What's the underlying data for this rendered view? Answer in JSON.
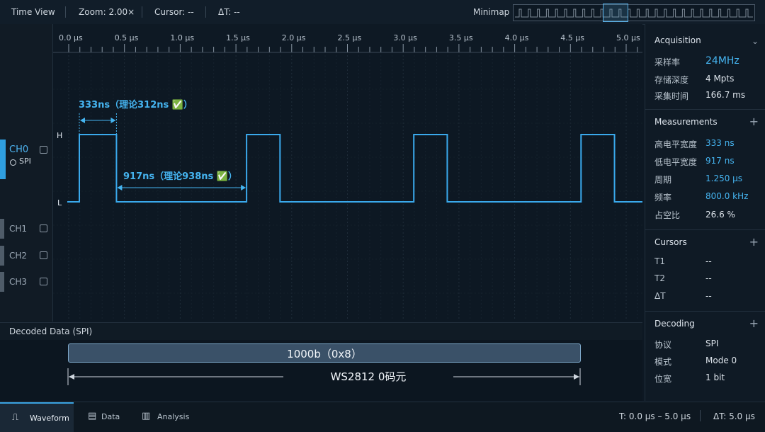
{
  "topbar": {
    "title": "Time View",
    "zoom": "Zoom:  2.00×",
    "cursor": "Cursor:  --",
    "delta": "ΔT:  --",
    "minimap_label": "Minimap"
  },
  "channels": [
    {
      "label": "CH0",
      "sub": "SPI",
      "color": "#2f9fe0",
      "active": true
    },
    {
      "label": "CH1",
      "color": "#4f5c69",
      "active": false
    },
    {
      "label": "CH2",
      "color": "#4f5c69",
      "active": false
    },
    {
      "label": "CH3",
      "color": "#4f5c69",
      "active": false
    }
  ],
  "ruler": {
    "ticks": [
      "0.0 μs",
      "0.5 μs",
      "1.0 μs",
      "1.5 μs",
      "2.0 μs",
      "2.5 μs",
      "3.0 μs",
      "3.5 μs",
      "4.0 μs",
      "4.5 μs",
      "5.0 μs"
    ]
  },
  "wave": {
    "high_label": "H",
    "low_label": "L",
    "high_us": [
      [
        0.0,
        0.333
      ],
      [
        1.5,
        1.8
      ],
      [
        3.0,
        3.3
      ],
      [
        4.5,
        4.8
      ]
    ],
    "annot_high": "333ns（理论312ns ✅）",
    "annot_low": "917ns（理论938ns ✅）",
    "signal_color": "#3aa9ec"
  },
  "decoded": {
    "title": "Decoded Data (SPI)",
    "bits": "1000b（0x8）",
    "meaning": "WS2812  0码元"
  },
  "acquisition": {
    "title": "Acquisition",
    "rows": [
      {
        "k": "采样率",
        "v": "24MHz"
      },
      {
        "k": "存储深度",
        "v": "4 Mpts"
      },
      {
        "k": "采集时间",
        "v": "166.7 ms"
      }
    ]
  },
  "measurements": {
    "title": "Measurements",
    "add": "+",
    "rows": [
      {
        "k": "高电平宽度",
        "v": "333 ns"
      },
      {
        "k": "低电平宽度",
        "v": "917 ns"
      },
      {
        "k": "周期",
        "v": "1.250 μs"
      },
      {
        "k": "频率",
        "v": "800.0 kHz"
      },
      {
        "k": "占空比",
        "v": "26.6 %"
      }
    ]
  },
  "cursors": {
    "title": "Cursors",
    "add": "+",
    "rows": [
      {
        "k": "T1",
        "v": "--"
      },
      {
        "k": "T2",
        "v": "--"
      },
      {
        "k": "ΔT",
        "v": "--"
      }
    ]
  },
  "decoding": {
    "title": "Decoding",
    "add": "+",
    "rows": [
      {
        "k": "协议",
        "v": "SPI"
      },
      {
        "k": "模式",
        "v": "Mode 0"
      },
      {
        "k": "位宽",
        "v": "1 bit"
      }
    ]
  },
  "bottombar": {
    "tabs": [
      {
        "label": "Waveform",
        "icon": "waveform-icon"
      },
      {
        "label": "Data",
        "icon": "data-icon"
      },
      {
        "label": "Analysis",
        "icon": "analysis-icon"
      }
    ],
    "trange": "T: 0.0 μs  –  5.0 μs",
    "dt": "ΔT:  5.0 μs"
  },
  "colors": {
    "accent": "#3aa9ec",
    "value_blue": "#45b4f0",
    "bg": "#0d1823"
  }
}
